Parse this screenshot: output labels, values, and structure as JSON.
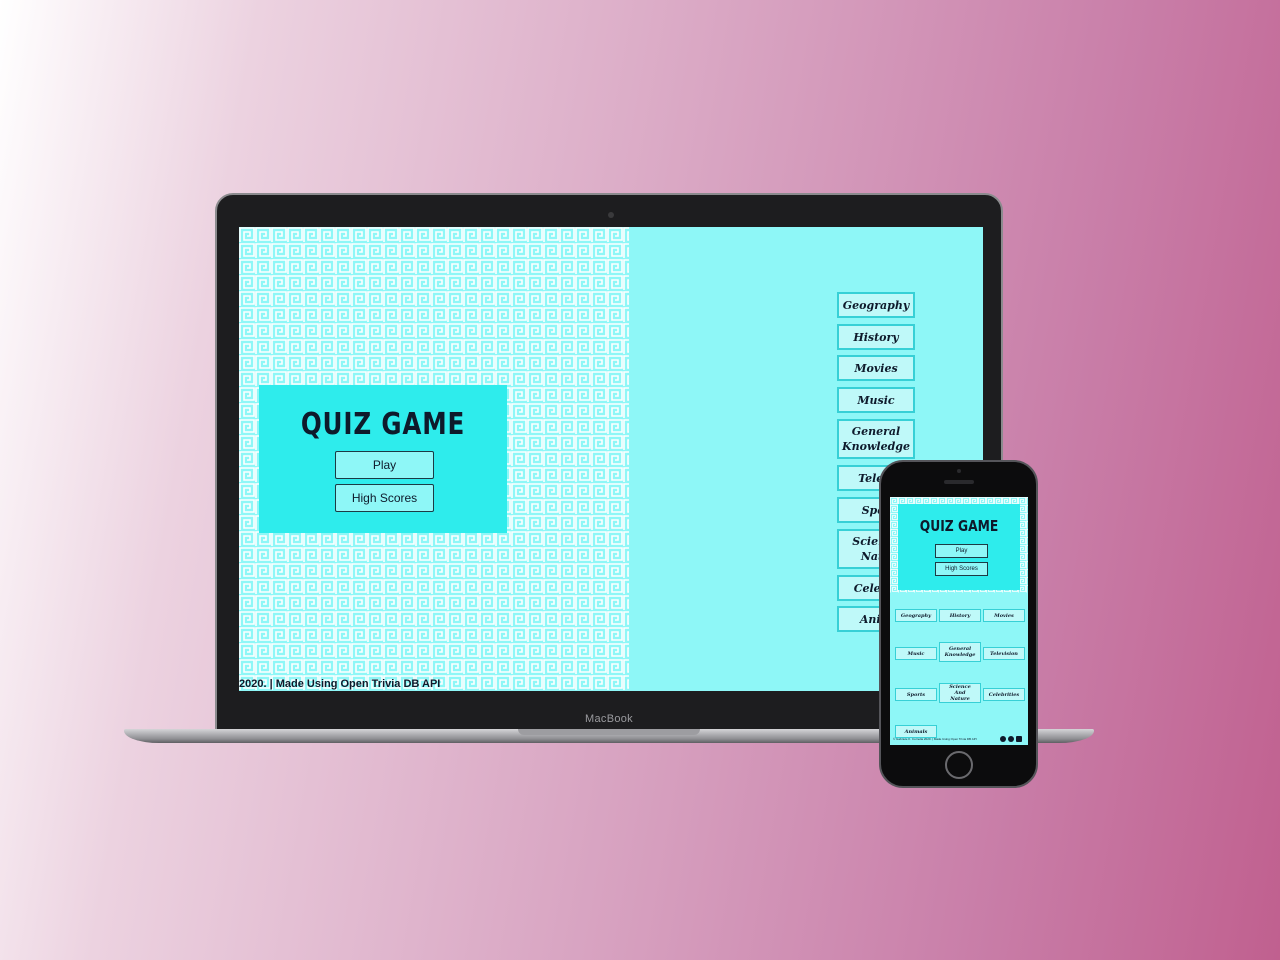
{
  "desktop": {
    "device_label": "MacBook",
    "title": "QUIZ GAME",
    "play_label": "Play",
    "high_scores_label": "High Scores",
    "footer_text": "2020. | Made Using Open Trivia DB API",
    "categories": [
      {
        "label": "Geography"
      },
      {
        "label": "History"
      },
      {
        "label": "Movies"
      },
      {
        "label": "Music"
      },
      {
        "label": "General Knowledge"
      },
      {
        "label": "Televi"
      },
      {
        "label": "Spor"
      },
      {
        "label": "Science Natu"
      },
      {
        "label": "Celebri"
      },
      {
        "label": "Anim"
      }
    ]
  },
  "mobile": {
    "title": "QUIZ GAME",
    "play_label": "Play",
    "high_scores_label": "High Scores",
    "footer_text": "© Gabriele K. Cornelia 2020. | Made Using Open Trivia DB API",
    "categories": [
      {
        "label": "Geography"
      },
      {
        "label": "History"
      },
      {
        "label": "Movies"
      },
      {
        "label": "Music"
      },
      {
        "label": "General Knowledge"
      },
      {
        "label": "Television"
      },
      {
        "label": "Sports"
      },
      {
        "label": "Science And Nature"
      },
      {
        "label": "Celebrities"
      },
      {
        "label": "Animals"
      }
    ],
    "social_icons": [
      "facebook-icon",
      "instagram-icon",
      "linkedin-icon"
    ]
  },
  "colors": {
    "screen_background": "#8ef7f7",
    "card_background": "#2eecec",
    "category_button_fill": "#bff9f9",
    "category_button_border": "#37d0d6",
    "text": "#0e1a2b"
  }
}
